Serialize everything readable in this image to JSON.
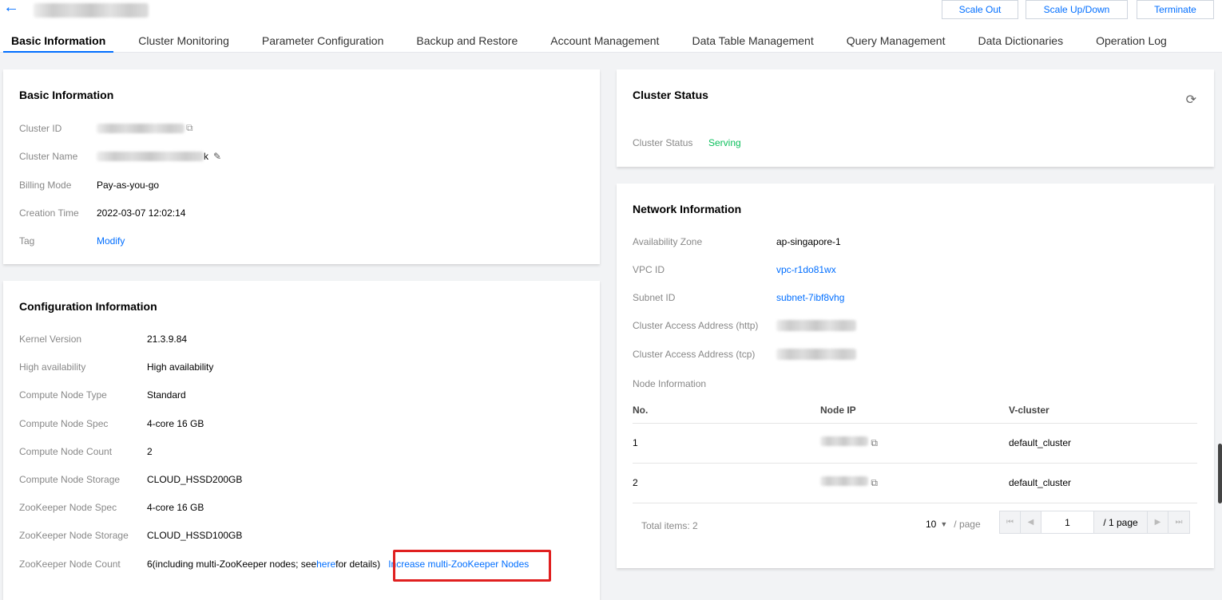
{
  "header": {
    "back_icon": "arrow-left-icon",
    "buttons": [
      "Scale Out",
      "Scale Up/Down",
      "Terminate"
    ]
  },
  "tabs": [
    "Basic Information",
    "Cluster Monitoring",
    "Parameter Configuration",
    "Backup and Restore",
    "Account Management",
    "Data Table Management",
    "Query Management",
    "Data Dictionaries",
    "Operation Log"
  ],
  "basic": {
    "title": "Basic Information",
    "cluster_id_label": "Cluster ID",
    "cluster_name_label": "Cluster Name",
    "cluster_name_suffix": "k",
    "billing_label": "Billing Mode",
    "billing": "Pay-as-you-go",
    "creation_label": "Creation Time",
    "creation": "2022-03-07 12:02:14",
    "tag_label": "Tag",
    "tag_link": "Modify"
  },
  "config": {
    "title": "Configuration Information",
    "rows": [
      {
        "label": "Kernel Version",
        "value": "21.3.9.84"
      },
      {
        "label": "High availability",
        "value": "High availability"
      },
      {
        "label": "Compute Node Type",
        "value": "Standard"
      },
      {
        "label": "Compute Node Spec",
        "value": "4-core 16 GB"
      },
      {
        "label": "Compute Node Count",
        "value": "2"
      },
      {
        "label": "Compute Node Storage",
        "value": "CLOUD_HSSD200GB"
      },
      {
        "label": "ZooKeeper Node Spec",
        "value": "4-core 16 GB"
      },
      {
        "label": "ZooKeeper Node Storage",
        "value": "CLOUD_HSSD100GB"
      }
    ],
    "zk_count_label": "ZooKeeper Node Count",
    "zk_count_pre": "6(including multi-ZooKeeper nodes; see ",
    "zk_here": "here",
    "zk_post": " for details)",
    "zk_increase": "Increase multi-ZooKeeper Nodes"
  },
  "status": {
    "title": "Cluster Status",
    "label": "Cluster Status",
    "value": "Serving",
    "status_color": "#0abf5b"
  },
  "network": {
    "title": "Network Information",
    "az_label": "Availability Zone",
    "az": "ap-singapore-1",
    "vpc_label": "VPC ID",
    "vpc": "vpc-r1do81wx",
    "subnet_label": "Subnet ID",
    "subnet": "subnet-7ibf8vhg",
    "http_label": "Cluster Access Address (http)",
    "tcp_label": "Cluster Access Address (tcp)",
    "node_label": "Node Information",
    "columns": [
      "No.",
      "Node IP",
      "V-cluster"
    ],
    "rows": [
      {
        "no": "1",
        "vcluster": "default_cluster"
      },
      {
        "no": "2",
        "vcluster": "default_cluster"
      }
    ],
    "total": "Total items:  2",
    "page_size": "10",
    "per_page": "/ page",
    "page": "1",
    "page_total": "/ 1 page"
  }
}
